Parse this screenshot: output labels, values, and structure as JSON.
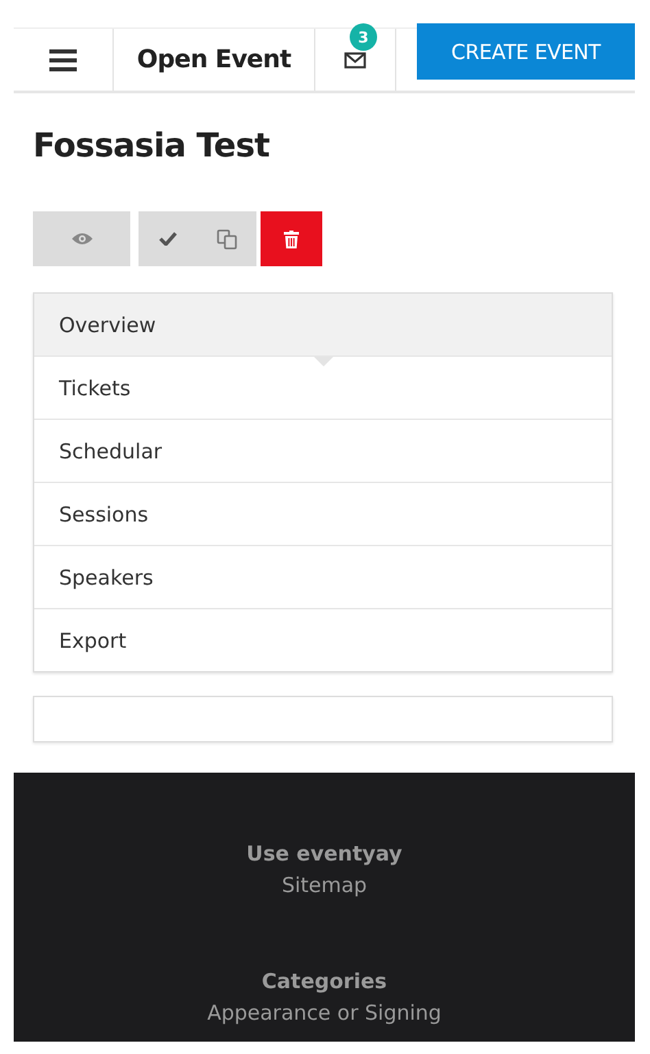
{
  "header": {
    "title": "Open Event",
    "notifications": "3",
    "create_button": "CREATE EVENT"
  },
  "event": {
    "title": "Fossasia Test"
  },
  "actions": [
    {
      "kind": "view"
    },
    {
      "kind": "publish"
    },
    {
      "kind": "copy"
    },
    {
      "kind": "delete"
    }
  ],
  "menu": [
    {
      "label": "Overview",
      "selected": true
    },
    {
      "label": "Tickets",
      "selected": false
    },
    {
      "label": "Schedular",
      "selected": false
    },
    {
      "label": "Sessions",
      "selected": false
    },
    {
      "label": "Speakers",
      "selected": false
    },
    {
      "label": "Export",
      "selected": false
    }
  ],
  "footer": [
    {
      "kind": "heading",
      "text": "Use eventyay"
    },
    {
      "kind": "link",
      "text": "Sitemap"
    },
    {
      "kind": "heading",
      "text": "Categories"
    },
    {
      "kind": "link",
      "text": "Appearance or Signing"
    }
  ]
}
